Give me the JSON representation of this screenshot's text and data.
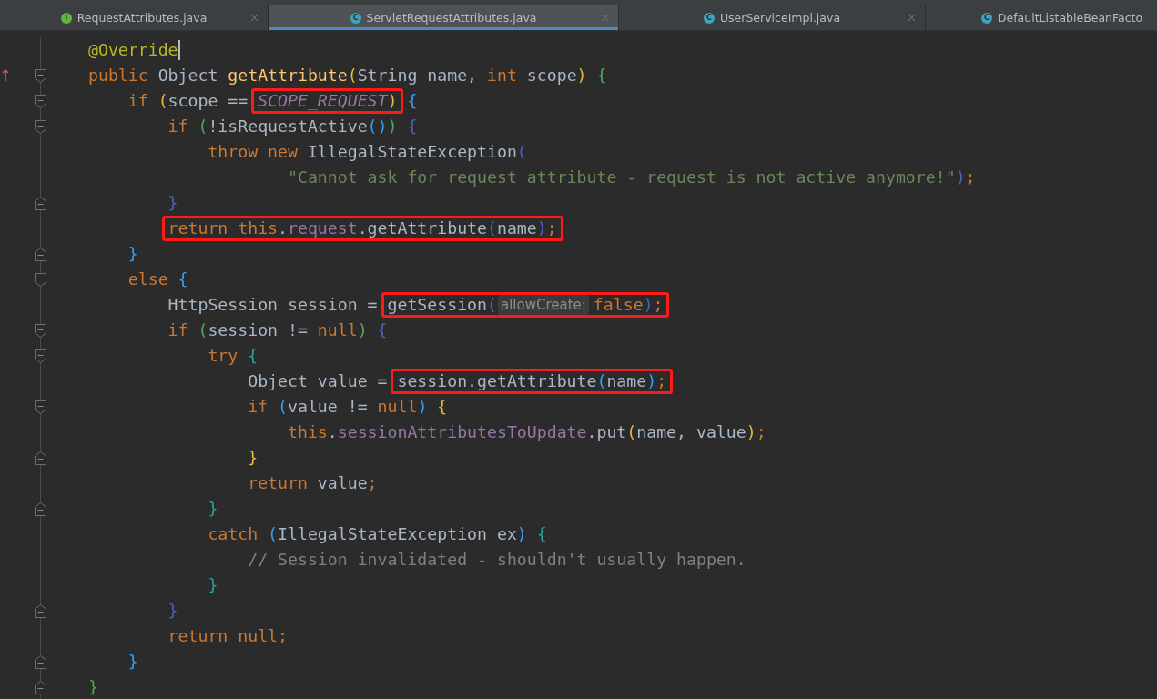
{
  "tabs": [
    {
      "label": "RequestAttributes.java",
      "badge": "I",
      "kind": "interface",
      "selected": false,
      "closable": true
    },
    {
      "label": "ServletRequestAttributes.java",
      "badge": "C",
      "kind": "class",
      "selected": true,
      "closable": true
    },
    {
      "label": "UserServiceImpl.java",
      "badge": "C",
      "kind": "class",
      "selected": false,
      "closable": true
    },
    {
      "label": "DefaultListableBeanFacto",
      "badge": "C",
      "kind": "class",
      "selected": false,
      "closable": false
    }
  ],
  "editor": {
    "lines": [
      {
        "kind": "code",
        "tokens": [
          {
            "text": "@Override",
            "kind": "annot",
            "cursor_after": true
          }
        ]
      },
      {
        "kind": "code",
        "gutter": [
          {
            "kind": "override"
          },
          {
            "kind": "fold_start"
          }
        ],
        "tokens": [
          {
            "text": "public ",
            "kind": "kw"
          },
          {
            "text": "Object ",
            "kind": "plain"
          },
          {
            "text": "getAttribute",
            "kind": "fn"
          },
          {
            "text": "(",
            "kind": "br",
            "color": "#e8ba36"
          },
          {
            "text": "String name, ",
            "kind": "plain"
          },
          {
            "text": "int ",
            "kind": "kw"
          },
          {
            "text": "scope",
            "kind": "plain"
          },
          {
            "text": ") ",
            "kind": "br",
            "color": "#e8ba36"
          },
          {
            "text": "{",
            "kind": "br",
            "color": "#54a857"
          }
        ],
        "children": [
          {
            "kind": "code",
            "gutter": [
              {
                "kind": "fold_start"
              }
            ],
            "tokens": [
              {
                "text": "if ",
                "kind": "kw"
              },
              {
                "text": "(",
                "kind": "br",
                "color": "#e8ba36"
              },
              {
                "text": "scope == ",
                "kind": "plain"
              },
              {
                "kind": "frame",
                "tokens": [
                  {
                    "text": "SCOPE_REQUEST",
                    "kind": "const"
                  },
                  {
                    "text": ")",
                    "kind": "br",
                    "color": "#e8ba36"
                  }
                ]
              },
              {
                "text": " {",
                "kind": "br",
                "color": "#359ff4"
              }
            ],
            "children": [
              {
                "kind": "code",
                "gutter": [
                  {
                    "kind": "fold_start"
                  }
                ],
                "tokens": [
                  {
                    "text": "if ",
                    "kind": "kw"
                  },
                  {
                    "text": "(",
                    "kind": "br",
                    "color": "#54a857"
                  },
                  {
                    "text": "!isRequestActive",
                    "kind": "plain"
                  },
                  {
                    "text": "()",
                    "kind": "br",
                    "color": "#359ff4"
                  },
                  {
                    "text": ") ",
                    "kind": "br",
                    "color": "#54a857"
                  },
                  {
                    "text": "{",
                    "kind": "br",
                    "color": "#5060bb"
                  }
                ],
                "children": [
                  {
                    "kind": "code",
                    "tokens": [
                      {
                        "text": "throw new ",
                        "kind": "kw"
                      },
                      {
                        "text": "IllegalStateException",
                        "kind": "plain"
                      },
                      {
                        "text": "(",
                        "kind": "br",
                        "color": "#5060bb"
                      }
                    ],
                    "children": [
                      {
                        "kind": "continuation",
                        "tokens": [
                          {
                            "text": "\"Cannot ask for request attribute - request is not active anymore!\"",
                            "kind": "str"
                          },
                          {
                            "text": ")",
                            "kind": "br",
                            "color": "#5060bb"
                          },
                          {
                            "text": ";",
                            "kind": "kw"
                          }
                        ]
                      }
                    ]
                  }
                ]
              },
              {
                "kind": "code",
                "gutter": [
                  {
                    "kind": "fold_end"
                  }
                ],
                "tokens": [
                  {
                    "text": "}",
                    "kind": "br",
                    "color": "#5060bb"
                  }
                ]
              },
              {
                "kind": "code",
                "tokens": [
                  {
                    "kind": "frame",
                    "tokens": [
                      {
                        "text": "return this",
                        "kind": "kw"
                      },
                      {
                        "text": ".",
                        "kind": "plain"
                      },
                      {
                        "text": "request",
                        "kind": "field"
                      },
                      {
                        "text": ".getAttribute",
                        "kind": "plain"
                      },
                      {
                        "text": "(",
                        "kind": "br",
                        "color": "#5060bb"
                      },
                      {
                        "text": "name",
                        "kind": "plain"
                      },
                      {
                        "text": ")",
                        "kind": "br",
                        "color": "#5060bb"
                      },
                      {
                        "text": ";",
                        "kind": "kw"
                      }
                    ]
                  }
                ]
              }
            ]
          },
          {
            "kind": "code",
            "gutter": [
              {
                "kind": "fold_end"
              }
            ],
            "tokens": [
              {
                "text": "}",
                "kind": "br",
                "color": "#359ff4"
              }
            ]
          },
          {
            "kind": "code",
            "gutter": [
              {
                "kind": "fold_start"
              }
            ],
            "tokens": [
              {
                "text": "else ",
                "kind": "kw"
              },
              {
                "text": "{",
                "kind": "br",
                "color": "#359ff4"
              }
            ],
            "children": [
              {
                "kind": "code",
                "tokens": [
                  {
                    "text": "HttpSession session = ",
                    "kind": "plain"
                  },
                  {
                    "kind": "frame",
                    "tokens": [
                      {
                        "text": "getSession",
                        "kind": "plain"
                      },
                      {
                        "text": "(",
                        "kind": "br",
                        "color": "#5060bb"
                      },
                      {
                        "text": "allowCreate:",
                        "kind": "hint"
                      },
                      {
                        "text": "false",
                        "kind": "kw"
                      },
                      {
                        "text": ")",
                        "kind": "br",
                        "color": "#5060bb"
                      },
                      {
                        "text": ";",
                        "kind": "kw"
                      }
                    ]
                  }
                ]
              },
              {
                "kind": "code",
                "gutter": [
                  {
                    "kind": "fold_start"
                  }
                ],
                "tokens": [
                  {
                    "text": "if ",
                    "kind": "kw"
                  },
                  {
                    "text": "(",
                    "kind": "br",
                    "color": "#54a857"
                  },
                  {
                    "text": "session != ",
                    "kind": "plain"
                  },
                  {
                    "text": "null",
                    "kind": "kw"
                  },
                  {
                    "text": ") ",
                    "kind": "br",
                    "color": "#54a857"
                  },
                  {
                    "text": "{",
                    "kind": "br",
                    "color": "#5060bb"
                  }
                ],
                "children": [
                  {
                    "kind": "code",
                    "gutter": [
                      {
                        "kind": "fold_start"
                      }
                    ],
                    "tokens": [
                      {
                        "text": "try ",
                        "kind": "kw"
                      },
                      {
                        "text": "{",
                        "kind": "br",
                        "color": "#26a69a"
                      }
                    ],
                    "children": [
                      {
                        "kind": "code",
                        "tokens": [
                          {
                            "text": "Object value = ",
                            "kind": "plain"
                          },
                          {
                            "kind": "frame",
                            "tokens": [
                              {
                                "text": "session.getAttribute",
                                "kind": "plain"
                              },
                              {
                                "text": "(",
                                "kind": "br",
                                "color": "#359ff4"
                              },
                              {
                                "text": "name",
                                "kind": "plain"
                              },
                              {
                                "text": ")",
                                "kind": "br",
                                "color": "#359ff4"
                              },
                              {
                                "text": ";",
                                "kind": "kw"
                              }
                            ]
                          }
                        ]
                      },
                      {
                        "kind": "code",
                        "gutter": [
                          {
                            "kind": "fold_start"
                          }
                        ],
                        "tokens": [
                          {
                            "text": "if ",
                            "kind": "kw"
                          },
                          {
                            "text": "(",
                            "kind": "br",
                            "color": "#359ff4"
                          },
                          {
                            "text": "value != ",
                            "kind": "plain"
                          },
                          {
                            "text": "null",
                            "kind": "kw"
                          },
                          {
                            "text": ") ",
                            "kind": "br",
                            "color": "#359ff4"
                          },
                          {
                            "text": "{",
                            "kind": "br",
                            "color": "#e8ba36"
                          }
                        ],
                        "children": [
                          {
                            "kind": "code",
                            "tokens": [
                              {
                                "text": "this",
                                "kind": "kw"
                              },
                              {
                                "text": ".",
                                "kind": "plain"
                              },
                              {
                                "text": "sessionAttributesToUpdate",
                                "kind": "field"
                              },
                              {
                                "text": ".put",
                                "kind": "plain"
                              },
                              {
                                "text": "(",
                                "kind": "br",
                                "color": "#e8ba36"
                              },
                              {
                                "text": "name, value",
                                "kind": "plain"
                              },
                              {
                                "text": ")",
                                "kind": "br",
                                "color": "#e8ba36"
                              },
                              {
                                "text": ";",
                                "kind": "kw"
                              }
                            ]
                          }
                        ]
                      },
                      {
                        "kind": "code",
                        "gutter": [
                          {
                            "kind": "fold_end"
                          }
                        ],
                        "tokens": [
                          {
                            "text": "}",
                            "kind": "br",
                            "color": "#e8ba36"
                          }
                        ]
                      },
                      {
                        "kind": "code",
                        "tokens": [
                          {
                            "text": "return ",
                            "kind": "kw"
                          },
                          {
                            "text": "value",
                            "kind": "plain"
                          },
                          {
                            "text": ";",
                            "kind": "kw"
                          }
                        ]
                      }
                    ]
                  },
                  {
                    "kind": "code",
                    "gutter": [
                      {
                        "kind": "fold_end"
                      }
                    ],
                    "tokens": [
                      {
                        "text": "}",
                        "kind": "br",
                        "color": "#26a69a"
                      }
                    ]
                  },
                  {
                    "kind": "code",
                    "tokens": [
                      {
                        "text": "catch ",
                        "kind": "kw"
                      },
                      {
                        "text": "(",
                        "kind": "br",
                        "color": "#359ff4"
                      },
                      {
                        "text": "IllegalStateException ex",
                        "kind": "plain"
                      },
                      {
                        "text": ") ",
                        "kind": "br",
                        "color": "#359ff4"
                      },
                      {
                        "text": "{",
                        "kind": "br",
                        "color": "#26a69a"
                      }
                    ],
                    "children": [
                      {
                        "kind": "code",
                        "tokens": [
                          {
                            "text": "// Session invalidated - shouldn't usually happen.",
                            "kind": "comment"
                          }
                        ]
                      }
                    ]
                  },
                  {
                    "kind": "code",
                    "tokens": [
                      {
                        "text": "}",
                        "kind": "br",
                        "color": "#26a69a"
                      }
                    ]
                  }
                ]
              },
              {
                "kind": "code",
                "gutter": [
                  {
                    "kind": "fold_end"
                  }
                ],
                "tokens": [
                  {
                    "text": "}",
                    "kind": "br",
                    "color": "#5060bb"
                  }
                ]
              },
              {
                "kind": "code",
                "tokens": [
                  {
                    "text": "return null;",
                    "kind": "kw"
                  }
                ]
              }
            ]
          },
          {
            "kind": "code",
            "gutter": [
              {
                "kind": "fold_end"
              }
            ],
            "tokens": [
              {
                "text": "}",
                "kind": "br",
                "color": "#359ff4"
              }
            ]
          }
        ]
      },
      {
        "kind": "code",
        "gutter": [
          {
            "kind": "fold_end"
          }
        ],
        "tokens": [
          {
            "text": "}",
            "kind": "br",
            "color": "#54a857"
          }
        ]
      }
    ]
  }
}
